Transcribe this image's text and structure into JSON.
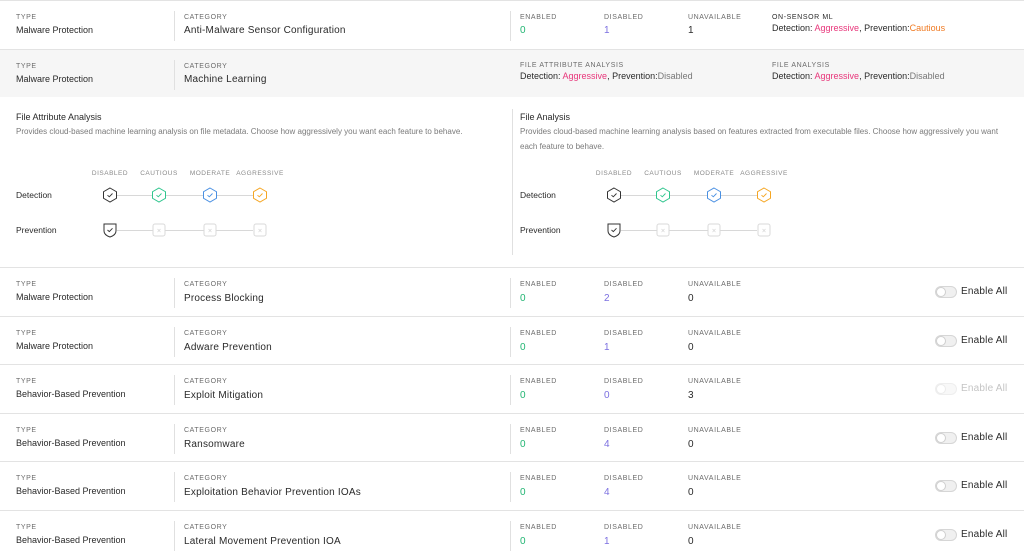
{
  "labels": {
    "type": "TYPE",
    "category": "CATEGORY",
    "enabled": "ENABLED",
    "disabled": "DISABLED",
    "unavailable": "UNAVAILABLE",
    "enable_all": "Enable All"
  },
  "header_row": {
    "type": "Malware Protection",
    "category": "Anti-Malware Sensor Configuration",
    "enabled": "0",
    "disabled": "1",
    "unavailable": "1",
    "onsensor_label": "ON-SENSOR ML",
    "onsensor_detection_prefix": "Detection: ",
    "onsensor_detection": "Aggressive",
    "onsensor_prevention_prefix": ", Prevention:",
    "onsensor_prevention": "Cautious"
  },
  "ml_row": {
    "type": "Malware Protection",
    "category": "Machine Learning",
    "faa_label": "FILE ATTRIBUTE ANALYSIS",
    "faa_detection_prefix": "Detection: ",
    "faa_detection": "Aggressive",
    "faa_prevention_prefix": ", Prevention:",
    "faa_prevention": "Disabled",
    "fa_label": "FILE ANALYSIS",
    "fa_detection_prefix": "Detection: ",
    "fa_detection": "Aggressive",
    "fa_prevention_prefix": ", Prevention:",
    "fa_prevention": "Disabled"
  },
  "ml_panels": [
    {
      "title": "File Attribute Analysis",
      "description": "Provides cloud-based machine learning analysis on file metadata. Choose how aggressively you want each feature to behave.",
      "levels": [
        "DISABLED",
        "CAUTIOUS",
        "MODERATE",
        "AGGRESSIVE"
      ],
      "detection_label": "Detection",
      "prevention_label": "Prevention",
      "detection_selected": "Aggressive",
      "prevention_selected": "Disabled"
    },
    {
      "title": "File Analysis",
      "description": "Provides cloud-based machine learning analysis based on features extracted from executable files. Choose how aggressively you want each feature to behave.",
      "levels": [
        "DISABLED",
        "CAUTIOUS",
        "MODERATE",
        "AGGRESSIVE"
      ],
      "detection_label": "Detection",
      "prevention_label": "Prevention",
      "detection_selected": "Aggressive",
      "prevention_selected": "Disabled"
    }
  ],
  "rows": [
    {
      "type": "Malware Protection",
      "category": "Process Blocking",
      "enabled": "0",
      "disabled": "2",
      "unavailable": "0",
      "toggle_enabled": true
    },
    {
      "type": "Malware Protection",
      "category": "Adware Prevention",
      "enabled": "0",
      "disabled": "1",
      "unavailable": "0",
      "toggle_enabled": true
    },
    {
      "type": "Behavior-Based Prevention",
      "category": "Exploit Mitigation",
      "enabled": "0",
      "disabled": "0",
      "unavailable": "3",
      "toggle_enabled": false
    },
    {
      "type": "Behavior-Based Prevention",
      "category": "Ransomware",
      "enabled": "0",
      "disabled": "4",
      "unavailable": "0",
      "toggle_enabled": true
    },
    {
      "type": "Behavior-Based Prevention",
      "category": "Exploitation Behavior Prevention IOAs",
      "enabled": "0",
      "disabled": "4",
      "unavailable": "0",
      "toggle_enabled": true
    },
    {
      "type": "Behavior-Based Prevention",
      "category": "Lateral Movement Prevention IOA",
      "enabled": "0",
      "disabled": "1",
      "unavailable": "0",
      "toggle_enabled": true
    }
  ],
  "colors": {
    "enabled": "#22b573",
    "disabled": "#7b6fe0",
    "aggressive": "#e8357a",
    "cautious": "#f07a22",
    "level_cautious": "#2fc58e",
    "level_moderate": "#4a90e2",
    "level_aggressive": "#f5a623"
  }
}
